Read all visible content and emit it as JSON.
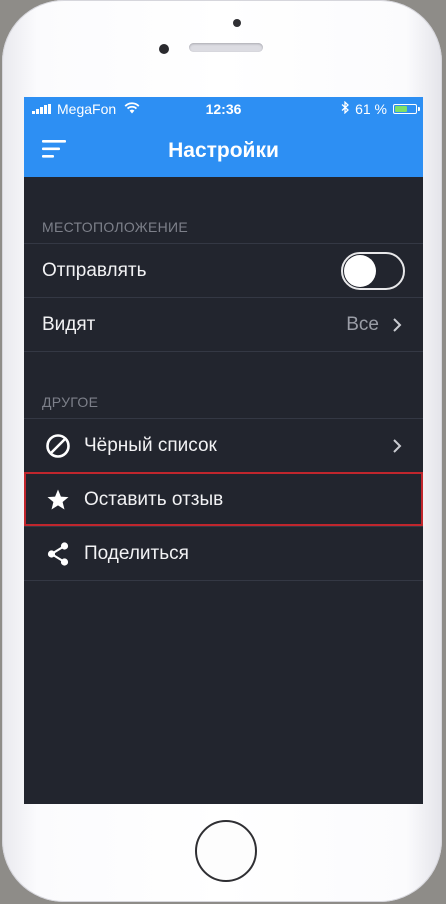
{
  "status_bar": {
    "carrier": "MegaFon",
    "time": "12:36",
    "battery": "61 %",
    "battery_level": 0.61,
    "icons": [
      "signal-icon",
      "wifi-icon",
      "bluetooth-icon",
      "battery-icon"
    ]
  },
  "nav": {
    "title": "Настройки",
    "menu_icon": "menu-icon"
  },
  "sections": {
    "location": {
      "header": "МЕСТОПОЛОЖЕНИЕ",
      "send": {
        "label": "Отправлять",
        "toggle_on": false
      },
      "visible": {
        "label": "Видят",
        "value": "Все"
      }
    },
    "other": {
      "header": "ДРУГОЕ",
      "blacklist": {
        "label": "Чёрный список",
        "icon": "block-icon"
      },
      "review": {
        "label": "Оставить отзыв",
        "icon": "star-icon"
      },
      "share": {
        "label": "Поделиться",
        "icon": "share-icon"
      }
    }
  },
  "colors": {
    "accent": "#2d8ff3",
    "background": "#22252e",
    "highlight": "#c0262d"
  }
}
